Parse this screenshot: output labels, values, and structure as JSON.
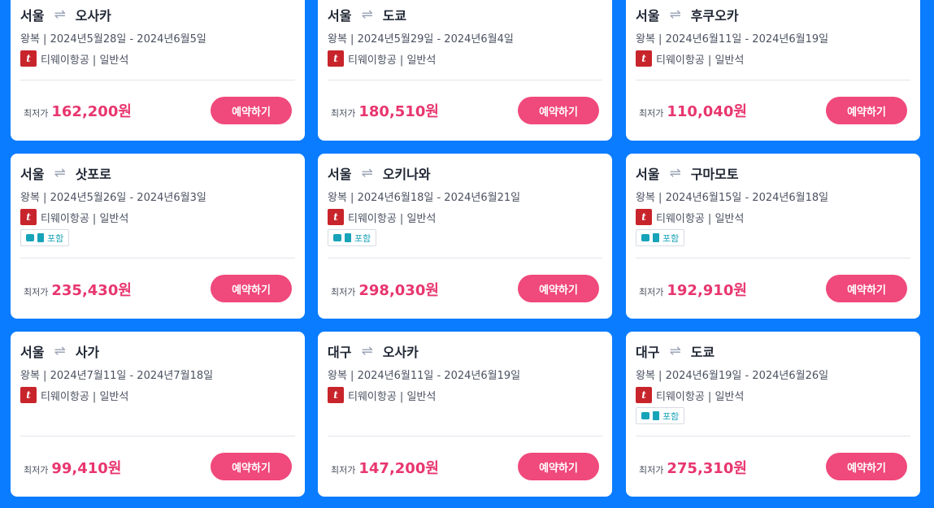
{
  "cards": [
    {
      "from": "서울",
      "to": "오사카",
      "dates": "왕복 | 2024년5월28일 - 2024년6월5일",
      "airline": "티웨이항공 | 일반석",
      "badge": "",
      "price_label": "최저가",
      "price": "162,200원",
      "button": "예약하기"
    },
    {
      "from": "서울",
      "to": "도쿄",
      "dates": "왕복 | 2024년5월29일 - 2024년6월4일",
      "airline": "티웨이항공 | 일반석",
      "badge": "",
      "price_label": "최저가",
      "price": "180,510원",
      "button": "예약하기"
    },
    {
      "from": "서울",
      "to": "후쿠오카",
      "dates": "왕복 | 2024년6월11일 - 2024년6월19일",
      "airline": "티웨이항공 | 일반석",
      "badge": "",
      "price_label": "최저가",
      "price": "110,040원",
      "button": "예약하기"
    },
    {
      "from": "서울",
      "to": "삿포로",
      "dates": "왕복 | 2024년5월26일 - 2024년6월3일",
      "airline": "티웨이항공 | 일반석",
      "badge": "포함",
      "price_label": "최저가",
      "price": "235,430원",
      "button": "예약하기"
    },
    {
      "from": "서울",
      "to": "오키나와",
      "dates": "왕복 | 2024년6월18일 - 2024년6월21일",
      "airline": "티웨이항공 | 일반석",
      "badge": "포함",
      "price_label": "최저가",
      "price": "298,030원",
      "button": "예약하기"
    },
    {
      "from": "서울",
      "to": "구마모토",
      "dates": "왕복 | 2024년6월15일 - 2024년6월18일",
      "airline": "티웨이항공 | 일반석",
      "badge": "포함",
      "price_label": "최저가",
      "price": "192,910원",
      "button": "예약하기"
    },
    {
      "from": "서울",
      "to": "사가",
      "dates": "왕복 | 2024년7월11일 - 2024년7월18일",
      "airline": "티웨이항공 | 일반석",
      "badge": "",
      "price_label": "최저가",
      "price": "99,410원",
      "button": "예약하기"
    },
    {
      "from": "대구",
      "to": "오사카",
      "dates": "왕복 | 2024년6월11일 - 2024년6월19일",
      "airline": "티웨이항공 | 일반석",
      "badge": "",
      "price_label": "최저가",
      "price": "147,200원",
      "button": "예약하기"
    },
    {
      "from": "대구",
      "to": "도쿄",
      "dates": "왕복 | 2024년6월19일 - 2024년6월26일",
      "airline": "티웨이항공 | 일반석",
      "badge": "포함",
      "price_label": "최저가",
      "price": "275,310원",
      "button": "예약하기"
    }
  ],
  "swap_glyph": "⇌",
  "airline_logo_glyph": "t",
  "colors": {
    "background": "#0a7cff",
    "price": "#e8366f",
    "button": "#f0497b",
    "badge": "#17a3b8"
  }
}
